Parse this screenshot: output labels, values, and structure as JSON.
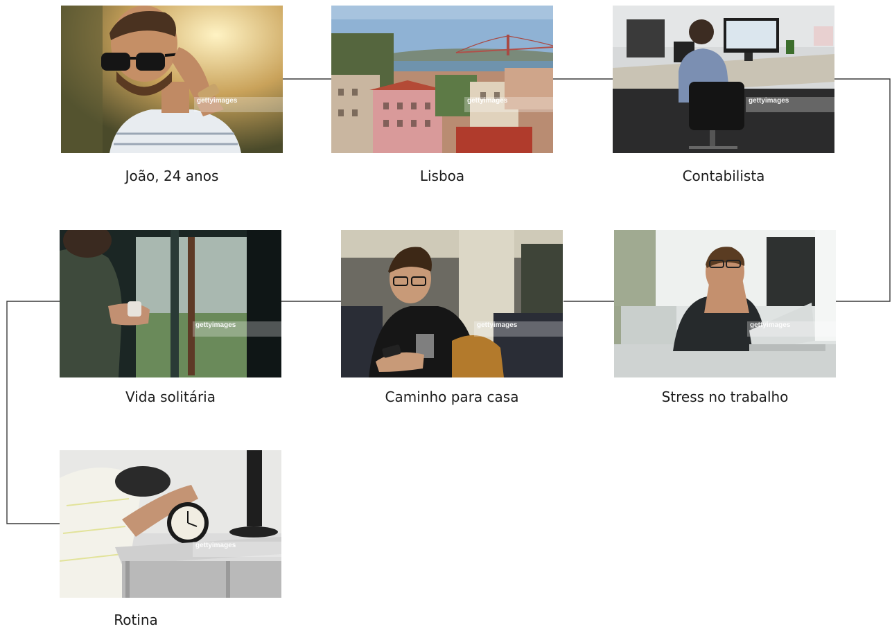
{
  "diagram": {
    "nodes": [
      {
        "id": "joao",
        "label": "João, 24 anos",
        "watermark": "gettyimages"
      },
      {
        "id": "lisboa",
        "label": "Lisboa",
        "watermark": "gettyimages"
      },
      {
        "id": "contabilista",
        "label": "Contabilista",
        "watermark": "gettyimages"
      },
      {
        "id": "vida-solitaria",
        "label": "Vida solitária",
        "watermark": "gettyimages"
      },
      {
        "id": "caminho-para-casa",
        "label": "Caminho para casa",
        "watermark": "gettyimages"
      },
      {
        "id": "stress-no-trabalho",
        "label": "Stress no trabalho",
        "watermark": "gettyimages"
      },
      {
        "id": "rotina",
        "label": "Rotina",
        "watermark": "gettyimages"
      }
    ],
    "edges": [
      [
        "joao",
        "lisboa"
      ],
      [
        "lisboa",
        "contabilista"
      ],
      [
        "contabilista",
        "stress-no-trabalho"
      ],
      [
        "stress-no-trabalho",
        "caminho-para-casa"
      ],
      [
        "caminho-para-casa",
        "vida-solitaria"
      ],
      [
        "vida-solitaria",
        "rotina"
      ]
    ],
    "line_color": "#3a3a3a"
  }
}
